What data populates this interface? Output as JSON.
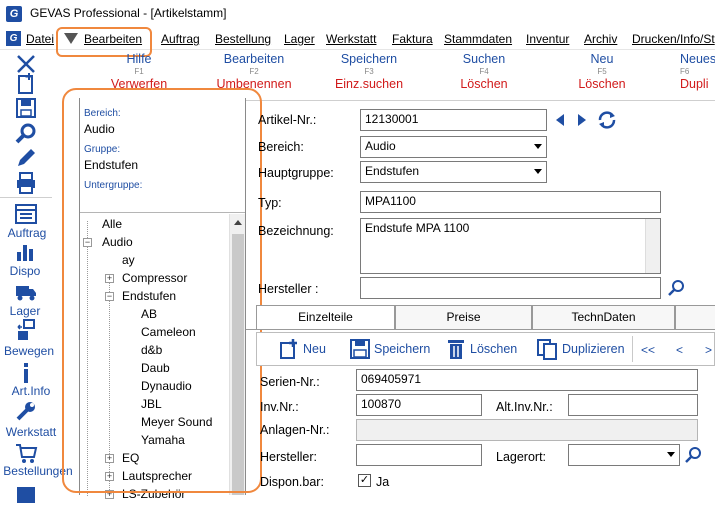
{
  "window": {
    "title": "GEVAS Professional - [Artikelstamm]",
    "icon": "G"
  },
  "menu": {
    "sys_icon": "G",
    "items": [
      "Datei",
      "Bearbeiten",
      "Auftrag",
      "Bestellung",
      "Lager",
      "Werkstatt",
      "Faktura",
      "Stammdaten",
      "Inventur",
      "Archiv",
      "Drucken/Info/St"
    ]
  },
  "fkeys": [
    {
      "label": "Hilfe",
      "key": "F1",
      "shift_label": "Verwerfen"
    },
    {
      "label": "Bearbeiten",
      "key": "F2",
      "shift_label": "Umbenennen"
    },
    {
      "label": "Speichern",
      "key": "F3",
      "shift_label": "Einz.suchen"
    },
    {
      "label": "Suchen",
      "key": "F4",
      "shift_label": "Löschen"
    },
    {
      "label": "Neu",
      "key": "F5",
      "shift_label": "Löschen"
    },
    {
      "label": "Neues",
      "key": "F6",
      "shift_label": "Dupli"
    }
  ],
  "toolbar": [
    "",
    "",
    "",
    "",
    "",
    "",
    "Auftrag",
    "Dispo",
    "Lager",
    "Bewegen",
    "Art.Info",
    "Werkstatt",
    "Bestellungen"
  ],
  "panel": {
    "bereich_label": "Bereich:",
    "bereich_value": "Audio",
    "gruppe_label": "Gruppe:",
    "gruppe_value": "Endstufen",
    "untergruppe_label": "Untergruppe:"
  },
  "tree": {
    "root": "Alle",
    "audio": "Audio",
    "ay": "ay",
    "compressor": "Compressor",
    "endstufen": "Endstufen",
    "children": [
      "AB",
      "Cameleon",
      "d&b",
      "Daub",
      "Dynaudio",
      "JBL",
      "Meyer Sound",
      "Yamaha"
    ],
    "eq": "EQ",
    "lautsprecher": "Lautsprecher",
    "ls_zubehoer": "LS-Zubehör"
  },
  "form": {
    "artikel_nr_label": "Artikel-Nr.:",
    "artikel_nr": "12130001",
    "bereich_label": "Bereich:",
    "bereich": "Audio",
    "hauptgruppe_label": "Hauptgruppe:",
    "hauptgruppe": "Endstufen",
    "typ_label": "Typ:",
    "typ": "MPA1100",
    "bezeichnung_label": "Bezeichnung:",
    "bezeichnung": "Endstufe MPA 1100",
    "hersteller_label": "Hersteller :",
    "hersteller": ""
  },
  "tabs": [
    "Einzelteile",
    "Preise",
    "TechnDaten"
  ],
  "subtoolbar": {
    "neu": "Neu",
    "speichern": "Speichern",
    "loeschen": "Löschen",
    "duplizieren": "Duplizieren",
    "first": "<<",
    "prev": "<",
    "next": ">"
  },
  "detail": {
    "serien_label": "Serien-Nr.:",
    "serien": "069405971",
    "inv_label": "Inv.Nr.:",
    "inv": "100870",
    "alt_inv_label": "Alt.Inv.Nr.:",
    "alt_inv": "",
    "anlagen_label": "Anlagen-Nr.:",
    "anlagen": "",
    "hersteller_label": "Hersteller:",
    "hersteller": "",
    "lagerort_label": "Lagerort:",
    "lagerort": "",
    "dispon_label": "Dispon.bar:",
    "dispon_value": "Ja"
  },
  "colors": {
    "accent": "#1f4ea3",
    "shift": "#d11a1a",
    "highlight": "#f0883e"
  }
}
